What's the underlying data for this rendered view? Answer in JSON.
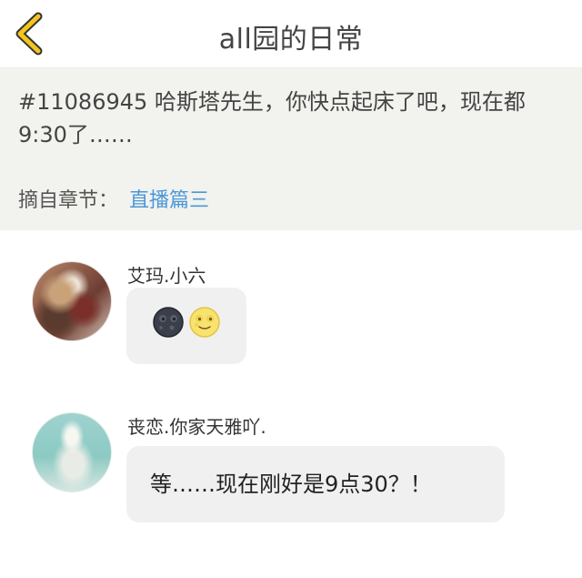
{
  "header": {
    "title": "all园的日常"
  },
  "quote": {
    "text": "#11086945 哈斯塔先生，你快点起床了吧，现在都9:30了……",
    "chapter_label": "摘自章节：",
    "chapter_link": "直播篇三"
  },
  "comments": [
    {
      "username": "艾玛.小六",
      "emojis": [
        "new-moon-face-icon",
        "full-moon-face-icon"
      ]
    },
    {
      "username": "丧恋.你家天雅吖.",
      "text": "等……现在刚好是9点30？！"
    }
  ],
  "colors": {
    "accent": "#f3c51d",
    "link": "#4a98d8",
    "quote_bg": "#f2f2ee",
    "bubble_bg": "#f0f0f0"
  }
}
